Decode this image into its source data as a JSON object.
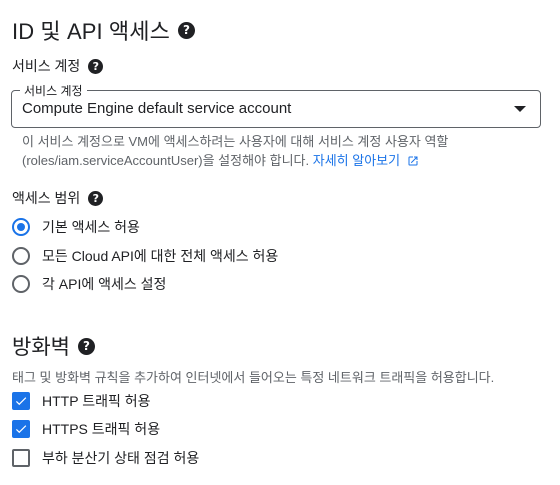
{
  "section_access": {
    "title": "ID 및 API 액세스",
    "service_account": {
      "label": "서비스 계정",
      "field_label": "서비스 계정",
      "value": "Compute Engine default service account",
      "hint_line1": "이 서비스 계정으로 VM에 액세스하려는 사용자에 대해 서비스 계정 사용자 역할",
      "hint_line2": "(roles/iam.serviceAccountUser)을 설정해야 합니다.",
      "learn_more": "자세히 알아보기"
    },
    "scope": {
      "label": "액세스 범위",
      "options": [
        {
          "label": "기본 액세스 허용",
          "selected": true
        },
        {
          "label": "모든 Cloud API에 대한 전체 액세스 허용",
          "selected": false
        },
        {
          "label": "각 API에 액세스 설정",
          "selected": false
        }
      ]
    }
  },
  "section_firewall": {
    "title": "방화벽",
    "description": "태그 및 방화벽 규칙을 추가하여 인터넷에서 들어오는 특정 네트워크 트래픽을 허용합니다.",
    "options": [
      {
        "label": "HTTP 트래픽 허용",
        "checked": true
      },
      {
        "label": "HTTPS 트래픽 허용",
        "checked": true
      },
      {
        "label": "부하 분산기 상태 점검 허용",
        "checked": false
      }
    ]
  },
  "colors": {
    "accent": "#1a73e8",
    "text": "#202124",
    "secondary": "#5f6368"
  },
  "icons": {
    "help": "help-circle-icon",
    "dropdown": "arrow-drop-down-icon",
    "external": "open-in-new-icon"
  }
}
